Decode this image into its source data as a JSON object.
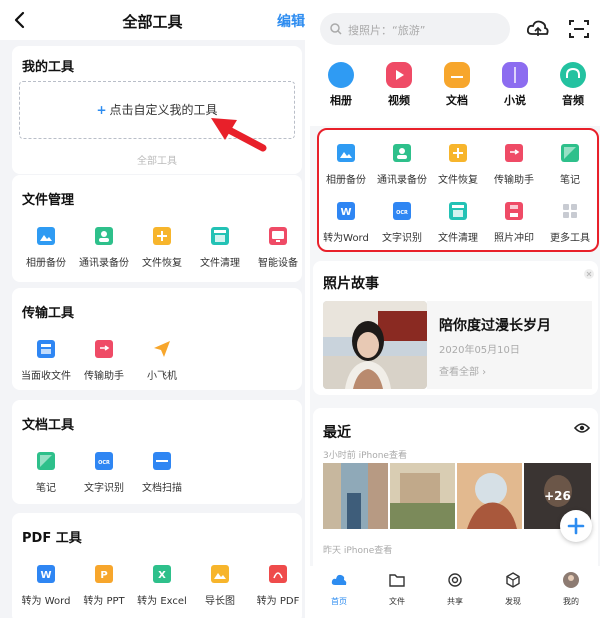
{
  "left": {
    "header": {
      "title": "全部工具",
      "edit_label": "编辑"
    },
    "my_tools": {
      "title": "我的工具",
      "customize_label": "点击自定义我的工具",
      "all_tools_label": "全部工具"
    },
    "sections": [
      {
        "title": "文件管理",
        "items": [
          "相册备份",
          "通讯录备份",
          "文件恢复",
          "文件清理",
          "智能设备"
        ]
      },
      {
        "title": "传输工具",
        "items": [
          "当面收文件",
          "传输助手",
          "小飞机"
        ]
      },
      {
        "title": "文档工具",
        "items": [
          "笔记",
          "文字识别",
          "文档扫描"
        ]
      },
      {
        "title": "PDF 工具",
        "items": [
          "转为 Word",
          "转为 PPT",
          "转为 Excel",
          "导长图",
          "转为 PDF"
        ]
      }
    ]
  },
  "right": {
    "search": {
      "placeholder": "搜照片：“旅游”"
    },
    "categories": [
      "相册",
      "视频",
      "文档",
      "小说",
      "音频"
    ],
    "tool_grid": {
      "row1": [
        "相册备份",
        "通讯录备份",
        "文件恢复",
        "传输助手",
        "笔记"
      ],
      "row2": [
        "转为Word",
        "文字识别",
        "文件清理",
        "照片冲印",
        "更多工具"
      ]
    },
    "story": {
      "title": "照片故事",
      "headline": "陪你度过漫长岁月",
      "date": "2020年05月10日",
      "view_all": "查看全部"
    },
    "recent": {
      "title": "最近",
      "sub1": "3小时前 iPhone查看",
      "more_count": "+26",
      "sub2": "昨天 iPhone查看"
    },
    "tabs": [
      "首页",
      "文件",
      "共享",
      "发现",
      "我的"
    ]
  },
  "colors": {
    "accent": "#2d8cf0",
    "highlight_border": "#e8202a",
    "arrow": "#e8202a"
  }
}
